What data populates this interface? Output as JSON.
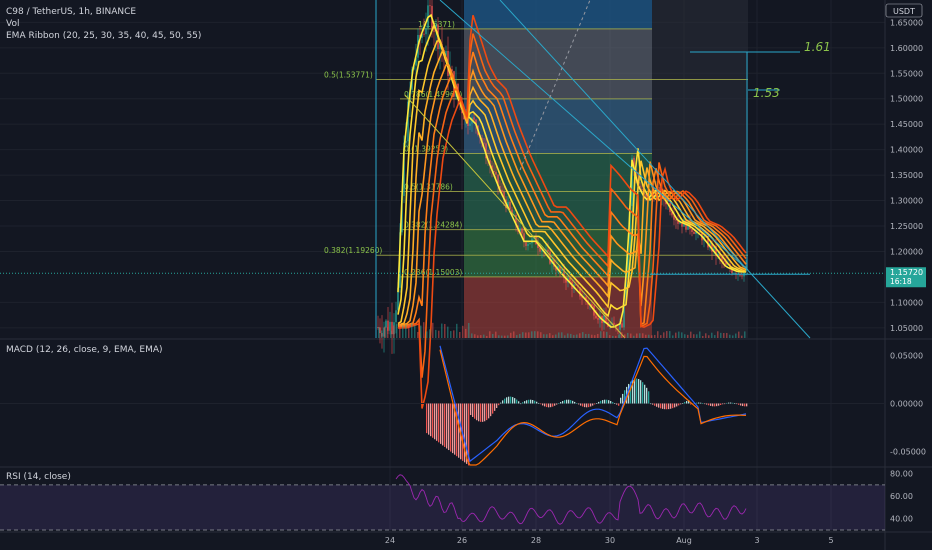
{
  "header": {
    "symbol": "C98 / TetherUS, 1h, BINANCE",
    "volume": "Vol",
    "ema_ribbon": "EMA Ribbon (20, 25, 30, 35, 40, 45, 50, 55)"
  },
  "macd_label": "MACD (12, 26, close, 9, EMA, EMA)",
  "rsi_label": "RSI (14, close)",
  "colors": {
    "background": "#131722",
    "up": "#26a69a",
    "down": "#ef5350",
    "ribbon": [
      "#ffeb3b",
      "#ffdd33",
      "#ffc62b",
      "#ffae24",
      "#ff961e",
      "#ff7e18",
      "#f76414",
      "#ef4a12"
    ],
    "macd_line": "#2962ff",
    "signal_line": "#ff6d00",
    "rsi_line": "#9c27b0",
    "trendline": "#2aa7c9",
    "fib_line": "#aab24a"
  },
  "chart_data": {
    "type": "candlestick",
    "main": {
      "currency": "USDT",
      "y_ticks": [
        "1.65000",
        "1.60000",
        "1.55000",
        "1.50000",
        "1.45000",
        "1.40000",
        "1.35000",
        "1.30000",
        "1.25000",
        "1.20000",
        "1.10000",
        "1.05000"
      ],
      "ylim": [
        1.03,
        1.69
      ],
      "current_price": "1.15720",
      "countdown": "16:18",
      "ribbon_periods": [
        20,
        25,
        30,
        35,
        40,
        45,
        50,
        55
      ]
    },
    "x_ticks": [
      "24",
      "26",
      "28",
      "30",
      "Aug",
      "3",
      "5"
    ],
    "fib_levels": [
      {
        "label": "0.5(1.53771)",
        "value": 1.53771
      },
      {
        "label": "0.382(1.19260)",
        "value": 1.1926
      },
      {
        "label": "0.786(1.49967)",
        "value": 1.49967
      },
      {
        "label": "0.(1.39253)",
        "value": 1.39253
      },
      {
        "label": "0.5(1.31786)",
        "value": 1.31786
      },
      {
        "label": "0.382(1.24284)",
        "value": 1.24284
      },
      {
        "label": "0.236(1.15003)",
        "value": 1.15003
      },
      {
        "label": "1(1.6371)",
        "value": 1.6371
      }
    ],
    "targets": [
      {
        "label": "1.61",
        "value": 1.61
      },
      {
        "label": "1.53",
        "value": 1.53
      }
    ],
    "macd": {
      "y_ticks": [
        "0.05000",
        "0.00000",
        "-0.05000"
      ],
      "ylim": [
        -0.065,
        0.065
      ]
    },
    "rsi": {
      "y_ticks": [
        "80.00",
        "60.00",
        "40.00"
      ],
      "ylim": [
        30,
        85
      ],
      "bands": [
        70,
        30
      ]
    }
  }
}
